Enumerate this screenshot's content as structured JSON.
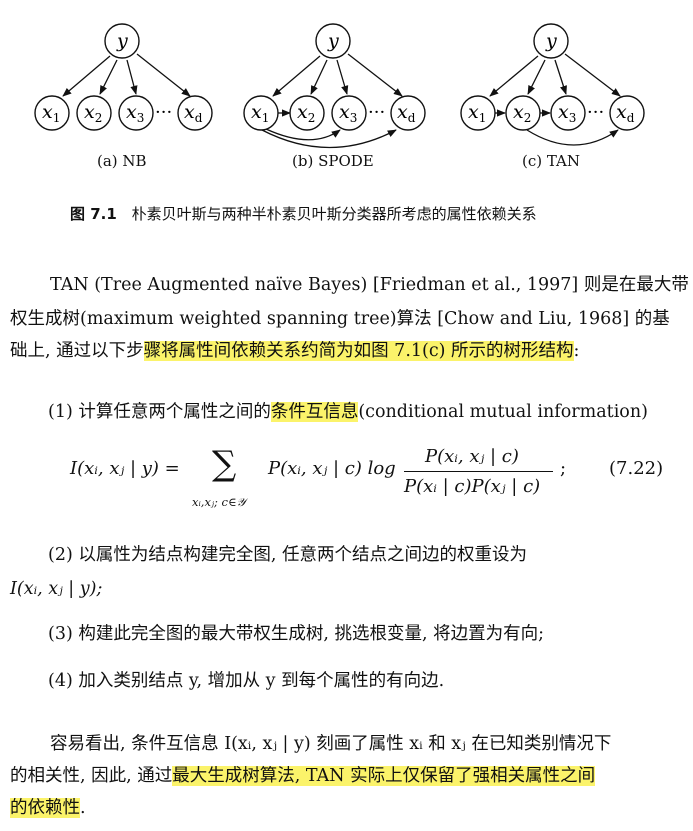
{
  "figure": {
    "nodes": {
      "y": "y",
      "x1": "x1",
      "x2": "x2",
      "x3": "x3",
      "xd": "xd",
      "dots": "···"
    },
    "subcaptions": [
      "(a) NB",
      "(b) SPODE",
      "(c) TAN"
    ],
    "caption_label": "图 7.1",
    "caption_text": "朴素贝叶斯与两种半朴素贝叶斯分类器所考虑的属性依赖关系"
  },
  "intro": {
    "l1": "TAN (Tree Augmented naïve Bayes) [Friedman et al., 1997] 则是在最大带",
    "l2": "权生成树(maximum weighted spanning tree)算法 [Chow and Liu, 1968] 的基",
    "l3_plain": "础上, 通过以下步",
    "l3_highlight": "骤将属性间依赖关系约简为如图 7.1(c) 所示的树形结构",
    "l3_end": ":"
  },
  "step1": {
    "pre": "(1) 计算任意两个属性之间的",
    "highlight": "条件互信息",
    "post": "(conditional mutual information)"
  },
  "equation": {
    "lhs": "I(xᵢ, xⱼ | y) =",
    "sum": "∑",
    "sum_sub": "xᵢ,xⱼ; c∈𝒴",
    "term": "P(xᵢ, xⱼ | c) log",
    "num": "P(xᵢ, xⱼ | c)",
    "den": "P(xᵢ | c)P(xⱼ | c)",
    "end": ";",
    "number": "(7.22)"
  },
  "step2": {
    "l1": "(2) 以属性为结点构建完全图, 任意两个结点之间边的权重设为",
    "l2": "I(xᵢ, xⱼ | y);"
  },
  "step3": "(3) 构建此完全图的最大带权生成树, 挑选根变量, 将边置为有向;",
  "step4": "(4) 加入类别结点 y, 增加从 y 到每个属性的有向边.",
  "conclusion": {
    "l1": "容易看出, 条件互信息 I(xᵢ, xⱼ | y) 刻画了属性 xᵢ 和 xⱼ 在已知类别情况下",
    "l2_plain": "的相关性, 因此, 通过",
    "l2_highlight": "最大生成树算法, TAN 实际上仅保留了强相关属性之间",
    "l3_highlight": "的依赖性",
    "l3_end": "."
  },
  "colors": {
    "highlight": "#fbf36a",
    "text": "#111111"
  }
}
